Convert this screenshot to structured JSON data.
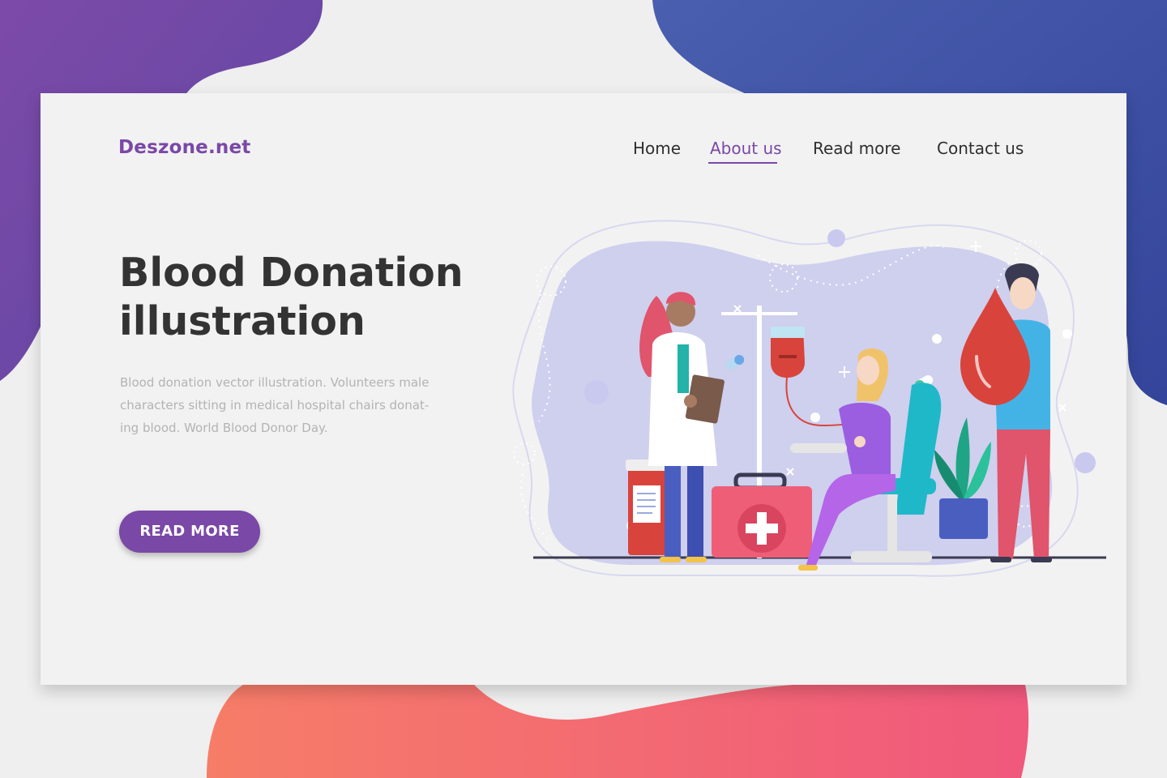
{
  "brand": {
    "logo": "Deszone.net",
    "accent_color": "#7a48a6"
  },
  "nav": {
    "items": [
      {
        "label": "Home",
        "active": false
      },
      {
        "label": "About us",
        "active": true
      },
      {
        "label": "Read more",
        "active": false
      },
      {
        "label": "Contact us",
        "active": false
      }
    ]
  },
  "hero": {
    "title_line1": "Blood Donation",
    "title_line2": "illustration",
    "description": "Blood donation vector illustration. Volunteers male characters sitting in medical hospital chairs donat-ing blood. World Blood Donor Day.",
    "cta_label": "READ MORE"
  },
  "illustration": {
    "subject": "blood donation scene",
    "icons": [
      "doctor-figure",
      "iv-drip-stand",
      "first-aid-kit",
      "donor-in-chair",
      "volunteer-with-blood-drop",
      "potted-plant",
      "pill-capsules"
    ]
  },
  "colors": {
    "blob_purple": "#7b4aa7",
    "blob_blue": "#3949a0",
    "blob_coral": "#f46f6f",
    "blood_red": "#d8443b",
    "illustration_bg": "#cfcfee"
  }
}
